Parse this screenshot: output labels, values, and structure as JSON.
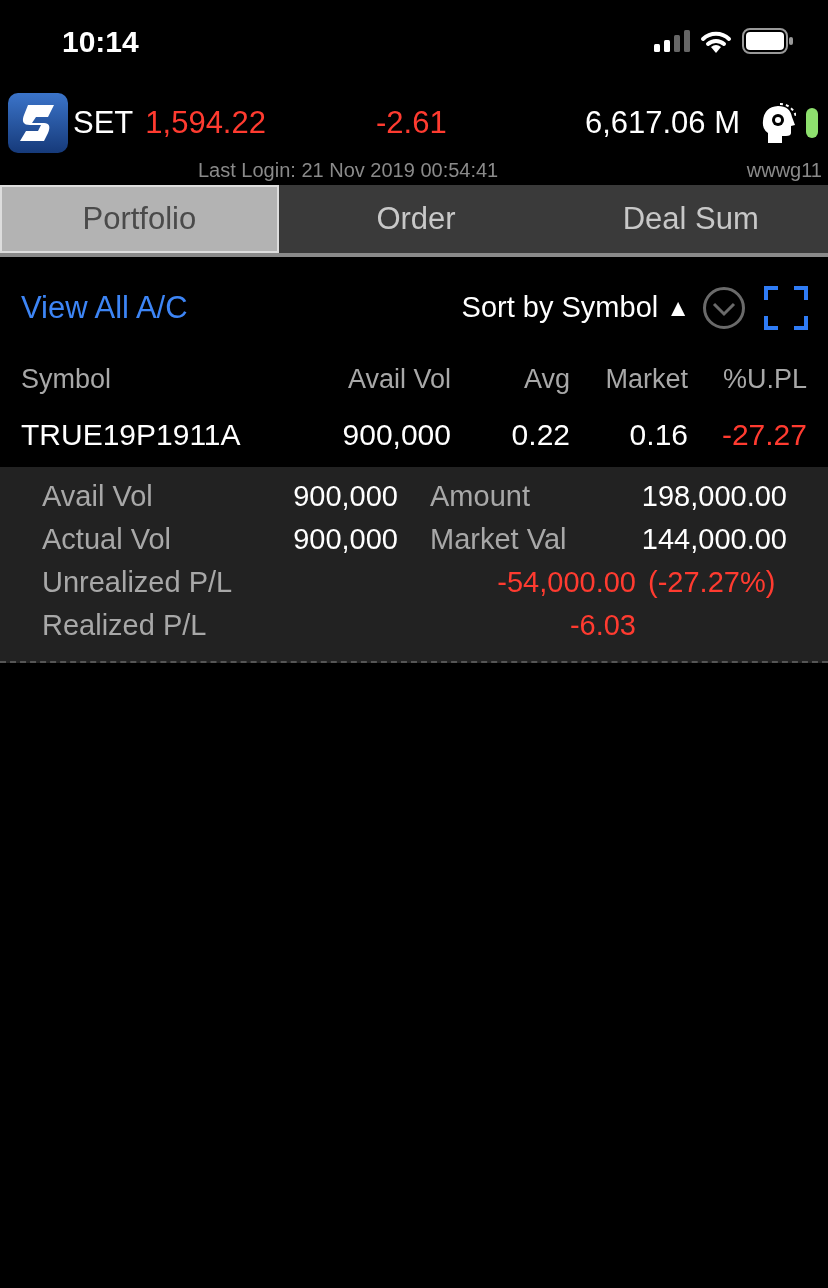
{
  "status_bar": {
    "time": "10:14"
  },
  "header": {
    "index_name": "SET",
    "index_value": "1,594.22",
    "change": "-2.61",
    "negative": true,
    "volume": "6,617.06 M",
    "last_login": "Last Login: 21 Nov 2019 00:54:41",
    "user": "wwwg11"
  },
  "tabs": [
    {
      "label": "Portfolio",
      "selected": true
    },
    {
      "label": "Order",
      "selected": false
    },
    {
      "label": "Deal Sum",
      "selected": false
    }
  ],
  "toolbar": {
    "view_all": "View All A/C",
    "sort": "Sort by Symbol",
    "sort_arrow": "▲"
  },
  "table": {
    "columns": [
      "Symbol",
      "Avail Vol",
      "Avg",
      "Market",
      "%U.PL"
    ],
    "rows": [
      {
        "cells": [
          "TRUE19P1911A",
          "900,000",
          "0.22",
          "0.16",
          "-27.27"
        ],
        "negative": true,
        "expanded": true
      }
    ]
  },
  "detail": {
    "pairs": [
      {
        "label": "Avail Vol",
        "value": "900,000",
        "label2": "Amount",
        "value2": "198,000.00"
      },
      {
        "label": "Actual Vol",
        "value": "900,000",
        "label2": "Market Val",
        "value2": "144,000.00"
      }
    ],
    "pl": [
      {
        "label": "Unrealized P/L",
        "value": "-54,000.00",
        "percent": "(-27.27%)",
        "negative": true
      },
      {
        "label": "Realized P/L",
        "value": "-6.03",
        "negative": true
      }
    ]
  }
}
